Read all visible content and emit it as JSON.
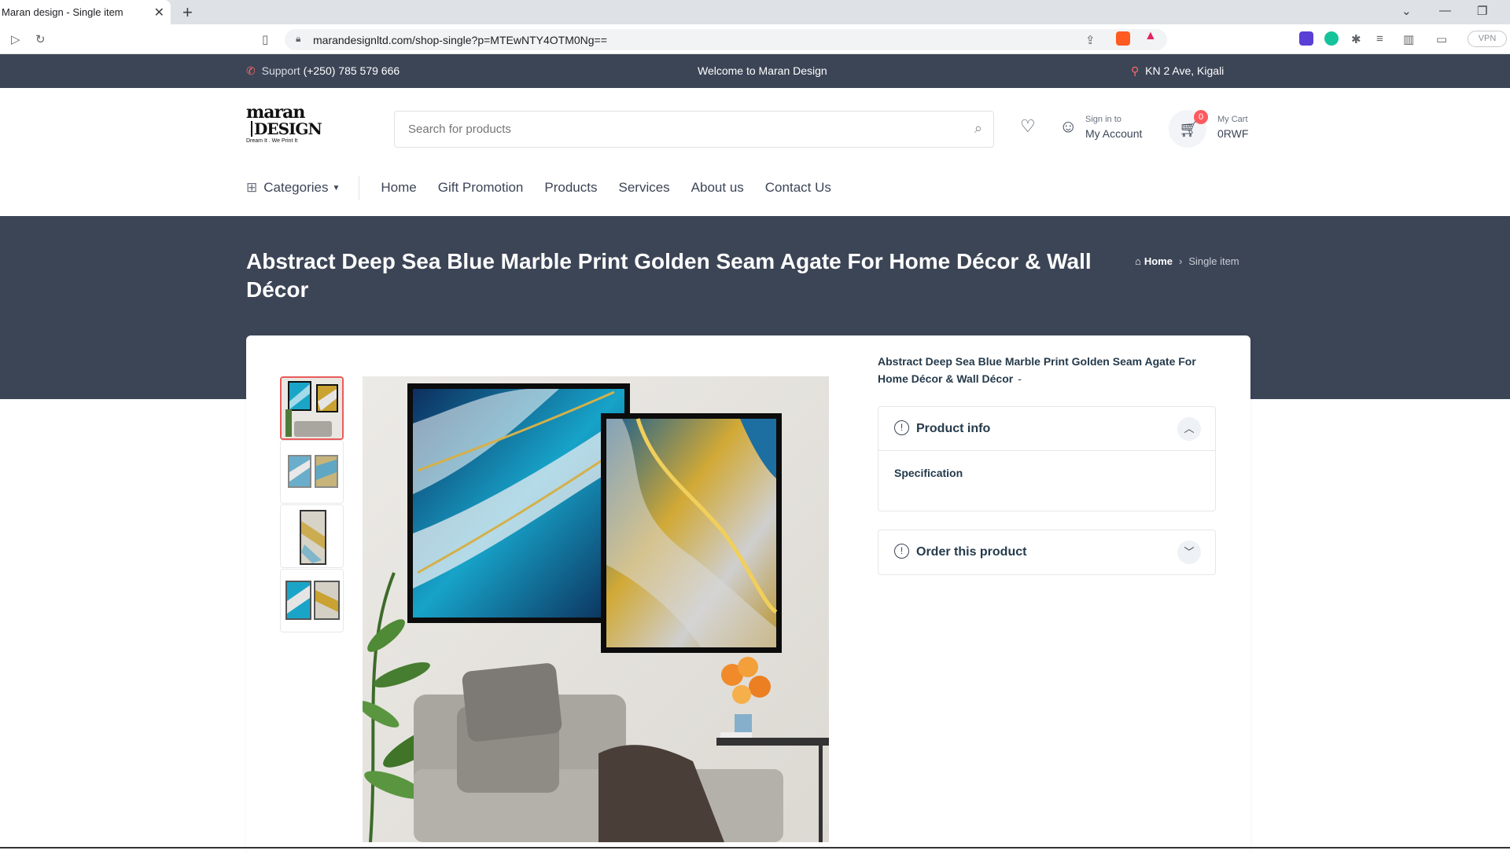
{
  "browser": {
    "tab_title": "Maran design - Single item",
    "url": "marandesignltd.com/shop-single?p=MTEwNTY4OTM0Ng==",
    "vpn_label": "VPN"
  },
  "infobar": {
    "support_label": "Support",
    "support_phone": "(+250) 785 579 666",
    "welcome": "Welcome to Maran Design",
    "location": "KN 2 Ave, Kigali"
  },
  "header": {
    "logo_line1": "maran",
    "logo_line2": "DESIGN",
    "logo_tagline": "Dream It . We Print It",
    "search_placeholder": "Search for products",
    "account_small": "Sign in to",
    "account_big": "My Account",
    "cart_count": "0",
    "cart_small": "My Cart",
    "cart_big": "0RWF"
  },
  "nav": {
    "categories": "Categories",
    "links": [
      "Home",
      "Gift Promotion",
      "Products",
      "Services",
      "About us",
      "Contact Us"
    ]
  },
  "banner": {
    "title": "Abstract Deep Sea Blue Marble Print Golden Seam Agate For Home Décor & Wall Décor",
    "crumb_home": "Home",
    "crumb_current": "Single item"
  },
  "product": {
    "name": "Abstract Deep Sea Blue Marble Print Golden Seam Agate For Home Décor & Wall Décor",
    "name_suffix": "-",
    "accordion": [
      {
        "title": "Product info",
        "body": "Specification",
        "open": true
      },
      {
        "title": "Order this product",
        "open": false
      }
    ]
  },
  "colors": {
    "dark_navy": "#3c4556",
    "accent_red": "#e95b5b",
    "ocean_blue": "#1aa5c8",
    "gold": "#c9a232"
  }
}
